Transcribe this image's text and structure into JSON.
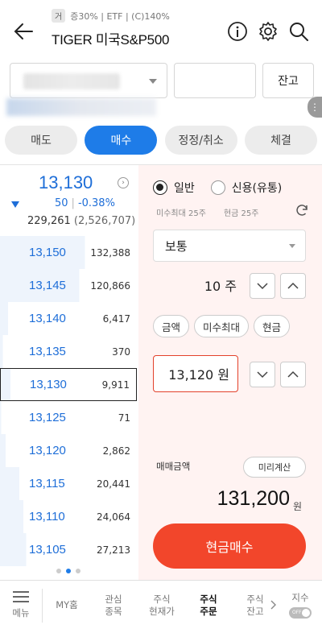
{
  "header": {
    "market_badge": "거",
    "tags_text": "증30% | ETF | (C)140%",
    "title": "TIGER 미국S&P500"
  },
  "account": {
    "balance_label": "잔고",
    "more_label": "⋮"
  },
  "tabs": [
    {
      "label": "매도",
      "active": false
    },
    {
      "label": "매수",
      "active": true
    },
    {
      "label": "정정/취소",
      "active": false
    },
    {
      "label": "체결",
      "active": false
    }
  ],
  "quote": {
    "current_price": "13,130",
    "change": "50",
    "change_pct": "-0.38%",
    "volume": "229,261",
    "amount": "(2,526,707)",
    "info_label": "›"
  },
  "orderbook": [
    {
      "price": "13,150",
      "qty": "132,388",
      "bar": 0.62
    },
    {
      "price": "13,145",
      "qty": "120,866",
      "bar": 0.58
    },
    {
      "price": "13,140",
      "qty": "6,417",
      "bar": 0.06
    },
    {
      "price": "13,135",
      "qty": "370",
      "bar": 0.02
    },
    {
      "price": "13,130",
      "qty": "9,911",
      "bar": 0.07
    },
    {
      "price": "13,125",
      "qty": "71",
      "bar": 0.01
    },
    {
      "price": "13,120",
      "qty": "2,862",
      "bar": 0.04
    },
    {
      "price": "13,115",
      "qty": "20,441",
      "bar": 0.14
    },
    {
      "price": "13,110",
      "qty": "24,064",
      "bar": 0.17
    },
    {
      "price": "13,105",
      "qty": "27,213",
      "bar": 0.19
    }
  ],
  "order": {
    "radio_normal": "일반",
    "radio_credit": "신용(유통)",
    "hint_max": "미수최대 25주",
    "hint_cash": "현금 25주",
    "order_type": "보통",
    "quantity": "10 주",
    "pill_amount": "금액",
    "pill_max": "미수최대",
    "pill_cash": "현금",
    "price": "13,120 원",
    "total_label": "매매금액",
    "precalc_label": "미리계산",
    "total_value": "131,200",
    "total_unit": "원",
    "buy_button": "현금매수"
  },
  "bottom_nav": {
    "menu": "메뉴",
    "my_home": "MY홈",
    "watch": "관심\n종목",
    "current": "주식\n현재가",
    "order": "주식\n주문",
    "balance": "주식\n잔고",
    "index": "지수",
    "toggle": "OFF"
  },
  "colors": {
    "accent": "#1e7ce8",
    "down": "#1e6ed8",
    "buy": "#f2462b",
    "buy_panel_bg": "#fff3f2"
  }
}
